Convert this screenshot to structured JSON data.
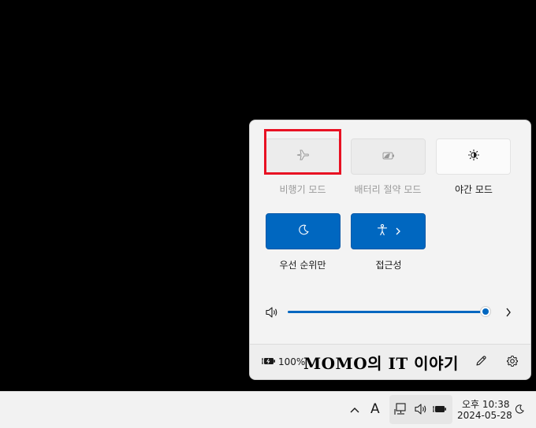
{
  "quick_settings": {
    "tiles": [
      {
        "label": "비행기 모드",
        "icon": "airplane-icon",
        "state": "disabled"
      },
      {
        "label": "배터리 절약 모드",
        "icon": "battery-saver-icon",
        "state": "disabled"
      },
      {
        "label": "야간 모드",
        "icon": "brightness-icon",
        "state": "off"
      },
      {
        "label": "우선 순위만",
        "icon": "moon-icon",
        "state": "on"
      },
      {
        "label": "접근성",
        "icon": "accessibility-icon",
        "state": "on"
      }
    ],
    "volume": {
      "level_percent": 100
    },
    "battery_text": "100%",
    "watermark": "MOMO의 IT 이야기"
  },
  "taskbar": {
    "ime_label": "A",
    "time": "오후 10:38",
    "date": "2024-05-28"
  },
  "colors": {
    "accent": "#0067c0",
    "highlight_box": "#e81123"
  }
}
